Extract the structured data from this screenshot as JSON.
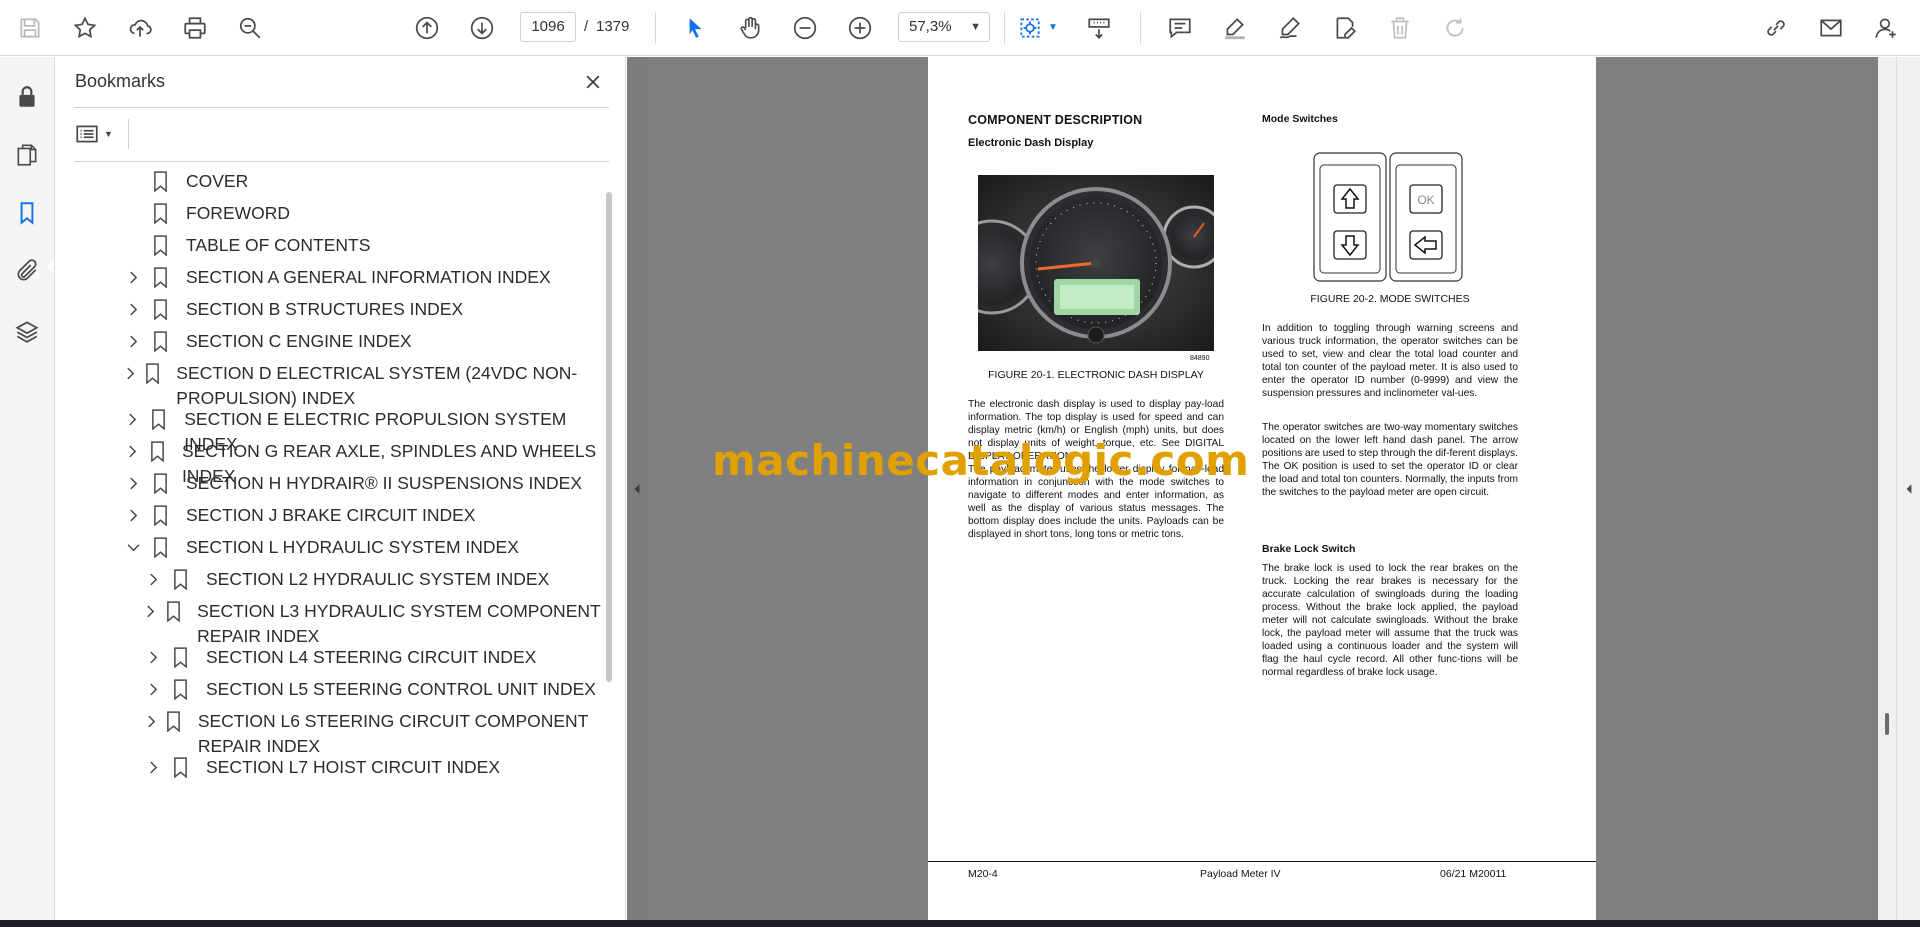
{
  "toolbar": {
    "page_current": "1096",
    "page_separator": "/",
    "page_total": "1379",
    "zoom": "57,3%",
    "icons": [
      "save-icon",
      "bookmark-star-icon",
      "upload-icon",
      "print-icon",
      "find-zoom-icon",
      "previous-page-icon",
      "next-page-icon",
      "zoom-out-icon",
      "zoom-in-icon",
      "select-cursor-icon",
      "hand-tool-icon",
      "marquee-zoom-icon",
      "scroll-mode-icon",
      "comment-icon",
      "highlight-icon",
      "sign-icon",
      "fill-sign-icon",
      "delete-icon",
      "redo-icon",
      "share-link-icon",
      "email-icon",
      "account-icon"
    ]
  },
  "rail": {
    "icons": [
      "lock-icon",
      "pages-icon",
      "bookmarks-icon",
      "attachments-icon",
      "layers-icon"
    ]
  },
  "bookmarks": {
    "title": "Bookmarks",
    "items": [
      {
        "label": "COVER",
        "level": 0,
        "expander": "none"
      },
      {
        "label": "FOREWORD",
        "level": 0,
        "expander": "none"
      },
      {
        "label": "TABLE OF CONTENTS",
        "level": 0,
        "expander": "none"
      },
      {
        "label": "SECTION A GENERAL INFORMATION INDEX",
        "level": 0,
        "expander": "collapsed"
      },
      {
        "label": "SECTION B STRUCTURES INDEX",
        "level": 0,
        "expander": "collapsed"
      },
      {
        "label": "SECTION C ENGINE INDEX",
        "level": 0,
        "expander": "collapsed"
      },
      {
        "label": "SECTION D ELECTRICAL SYSTEM (24VDC NON-PROPULSION) INDEX",
        "level": 0,
        "expander": "collapsed"
      },
      {
        "label": "SECTION E ELECTRIC PROPULSION SYSTEM INDEX",
        "level": 0,
        "expander": "collapsed"
      },
      {
        "label": "SECTION G REAR AXLE, SPINDLES AND WHEELS INDEX",
        "level": 0,
        "expander": "collapsed"
      },
      {
        "label": "SECTION H HYDRAIR® II SUSPENSIONS INDEX",
        "level": 0,
        "expander": "collapsed"
      },
      {
        "label": "SECTION J BRAKE CIRCUIT INDEX",
        "level": 0,
        "expander": "collapsed"
      },
      {
        "label": "SECTION L HYDRAULIC SYSTEM INDEX",
        "level": 0,
        "expander": "expanded"
      },
      {
        "label": "SECTION L2 HYDRAULIC SYSTEM INDEX",
        "level": 1,
        "expander": "collapsed"
      },
      {
        "label": "SECTION L3 HYDRAULIC SYSTEM COMPONENT REPAIR INDEX",
        "level": 1,
        "expander": "collapsed"
      },
      {
        "label": "SECTION L4 STEERING CIRCUIT INDEX",
        "level": 1,
        "expander": "collapsed"
      },
      {
        "label": "SECTION L5 STEERING CONTROL UNIT INDEX",
        "level": 1,
        "expander": "collapsed"
      },
      {
        "label": "SECTION L6 STEERING CIRCUIT COMPONENT REPAIR INDEX",
        "level": 1,
        "expander": "collapsed"
      },
      {
        "label": "SECTION L7 HOIST CIRCUIT INDEX",
        "level": 1,
        "expander": "collapsed"
      }
    ]
  },
  "page": {
    "heading": "COMPONENT DESCRIPTION",
    "sub_dash": "Electronic Dash Display",
    "photo_number": "84890",
    "caption_1": "FIGURE 20-1. ELECTRONIC DASH DISPLAY",
    "para_dash_1": "The electronic dash display is used to display pay-load information. The top display is used for speed and can display metric (km/h) or English (mph) units, but does not display units of weight, torque, etc. See DIGITAL DISPLAY OPERATION.",
    "para_dash_2": "The payload meter uses the lower display for pay-load information in conjunction with the mode switches to navigate to different modes and enter information, as well as the display of various status messages. The bottom display does include the units. Payloads can be displayed in short tons, long tons or metric tons.",
    "sub_mode": "Mode Switches",
    "switch_ok": "OK",
    "caption_2": "FIGURE 20-2. MODE SWITCHES",
    "para_mode_1": "In addition to toggling through warning screens and various truck information, the operator switches can be used to set, view and clear the total load counter and total ton counter of the payload meter. It is also used to enter the operator ID number (0-9999) and view the suspension pressures and inclinometer val-ues.",
    "para_mode_2": "The operator switches are two-way momentary switches located on the lower left hand dash panel. The arrow positions are used to step through the dif-ferent displays. The OK position is used to set the operator ID or clear the load and total ton counters. Normally, the inputs from the switches to the payload meter are open circuit.",
    "sub_brake": "Brake Lock Switch",
    "para_brake": "The brake lock is used to lock the rear brakes on the truck. Locking the rear brakes is necessary for the accurate calculation of swingloads during the loading process. Without the brake lock applied, the payload meter will not calculate swingloads. Without the brake lock, the payload meter will assume that the truck was loaded using a continuous loader and the system will flag the haul cycle record. All other func-tions will be normal regardless of brake lock usage.",
    "footer_left": "M20-4",
    "footer_center": "Payload Meter IV",
    "footer_right": "06/21   M20011"
  },
  "watermark": "machinecatalogic.com",
  "colors": {
    "accent_blue": "#1473e6",
    "doc_background": "#808080",
    "watermark": "#e0a000"
  }
}
